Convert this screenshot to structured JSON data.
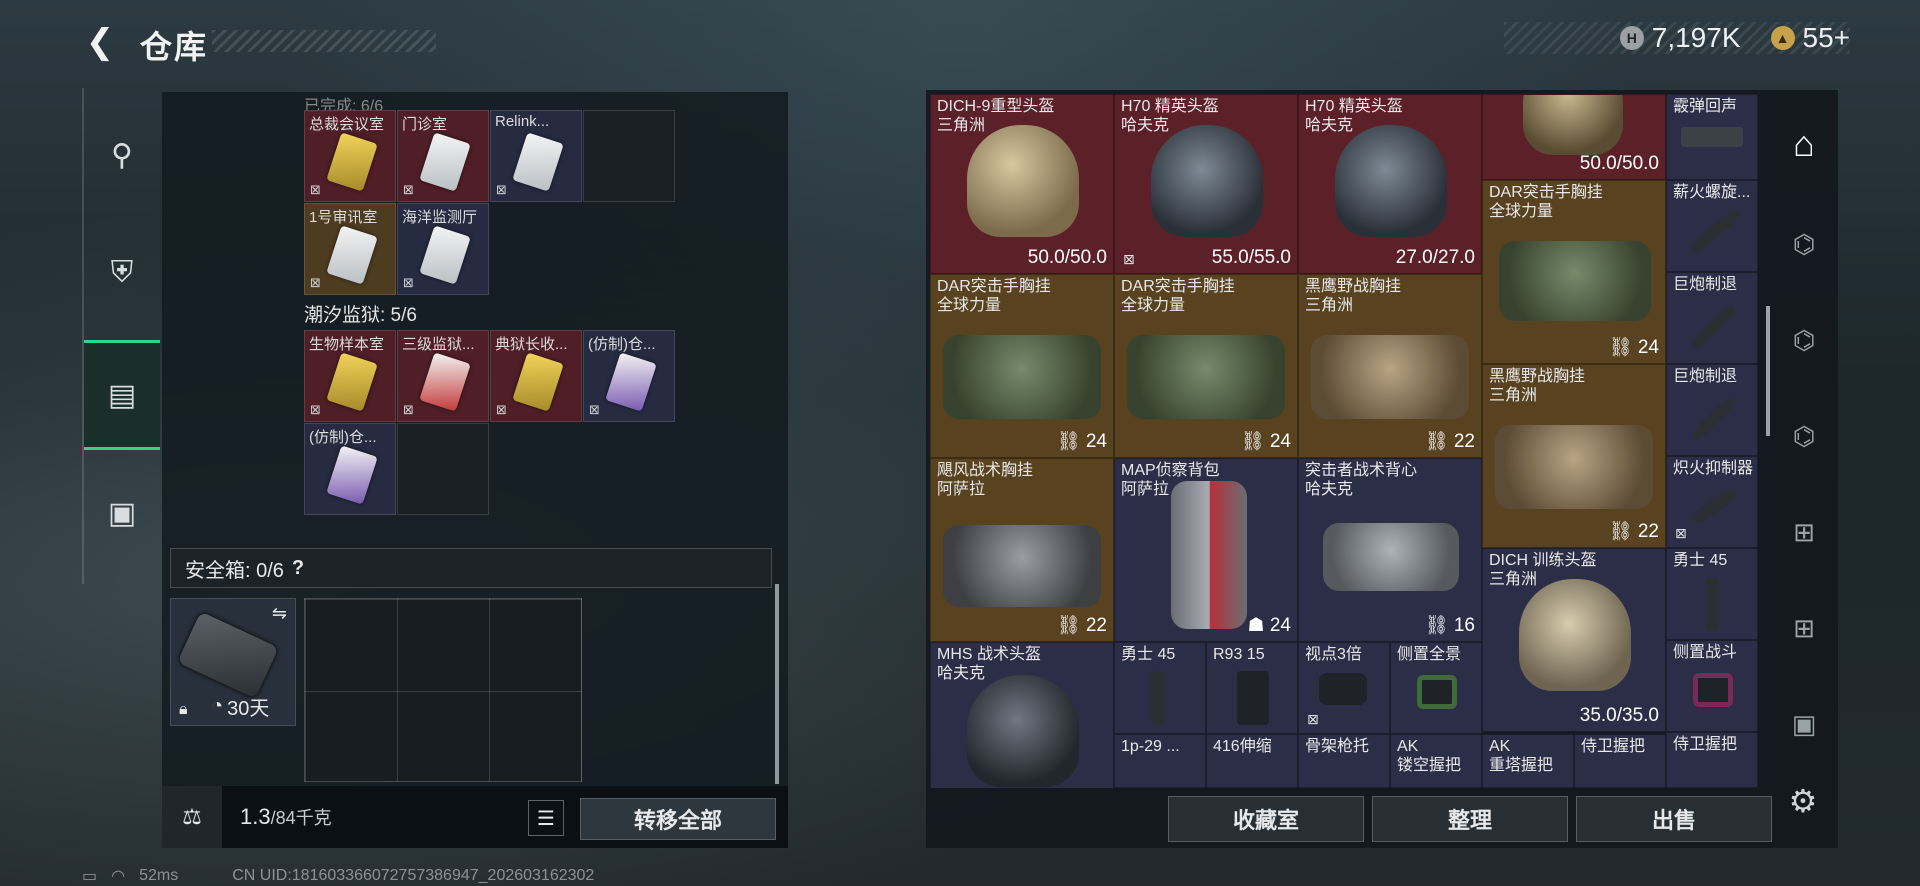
{
  "header": {
    "title": "仓库",
    "back_icon": "arrow-left-icon",
    "coins": "7,197K",
    "tickets": "55+"
  },
  "left_nav": [
    {
      "icon": "pistol-icon"
    },
    {
      "icon": "armor-icon"
    },
    {
      "icon": "keycard-icon",
      "active": true
    },
    {
      "icon": "briefcase-icon"
    }
  ],
  "left_panel": {
    "group1_cells": [
      "总裁会议室",
      "门诊室",
      "Relink...",
      "",
      "1号审讯室",
      "海洋监测厅"
    ],
    "prison_title": "潮汐监狱: 5/6",
    "prison_cells": [
      "生物样本室",
      "三级监狱...",
      "典狱长收...",
      "(仿制)仓...",
      "(仿制)仓..."
    ],
    "safe_box": {
      "label": "安全箱: 0/6",
      "help": "?",
      "duration": "30天"
    },
    "footer": {
      "weight": "1.3",
      "weight_max": "/84千克",
      "transfer_all": "转移全部"
    }
  },
  "inventory": [
    {
      "name": "DICH-9重型头盔",
      "origin": "三角洲",
      "value": "50.0/50.0"
    },
    {
      "name": "H70 精英头盔",
      "origin": "哈夫克",
      "value": "55.0/55.0"
    },
    {
      "name": "H70 精英头盔",
      "origin": "哈夫克",
      "value": "27.0/27.0"
    },
    {
      "name": "",
      "origin": "",
      "value": "50.0/50.0"
    },
    {
      "name": "霰弹回声",
      "origin": "",
      "value": ""
    },
    {
      "name": "DAR突击手胸挂",
      "origin": "全球力量",
      "value": "24"
    },
    {
      "name": "薪火螺旋...",
      "origin": "",
      "value": ""
    },
    {
      "name": "DAR突击手胸挂",
      "origin": "全球力量",
      "value": "24"
    },
    {
      "name": "DAR突击手胸挂",
      "origin": "全球力量",
      "value": "24"
    },
    {
      "name": "黑鹰野战胸挂",
      "origin": "三角洲",
      "value": "22"
    },
    {
      "name": "巨炮制退",
      "origin": "",
      "value": ""
    },
    {
      "name": "黑鹰野战胸挂",
      "origin": "三角洲",
      "value": "22"
    },
    {
      "name": "巨炮制退",
      "origin": "",
      "value": ""
    },
    {
      "name": "飓风战术胸挂",
      "origin": "阿萨拉",
      "value": "22"
    },
    {
      "name": "MAP侦察背包",
      "origin": "阿萨拉",
      "value": "24"
    },
    {
      "name": "突击者战术背心",
      "origin": "哈夫克",
      "value": "16"
    },
    {
      "name": "炽火抑制器",
      "origin": "",
      "value": ""
    },
    {
      "name": "DICH 训练头盔",
      "origin": "三角洲",
      "value": "35.0/35.0"
    },
    {
      "name": "勇士 45",
      "origin": "",
      "value": ""
    },
    {
      "name": "MHS 战术头盔",
      "origin": "哈夫克",
      "value": ""
    },
    {
      "name": "勇士 45",
      "origin": "",
      "value": ""
    },
    {
      "name": "R93 15",
      "origin": "",
      "value": ""
    },
    {
      "name": "视点3倍",
      "origin": "",
      "value": ""
    },
    {
      "name": "侧置全景",
      "origin": "",
      "value": ""
    },
    {
      "name": "侧置战斗",
      "origin": "",
      "value": ""
    },
    {
      "name": "1p-29 ...",
      "origin": "",
      "value": ""
    },
    {
      "name": "416伸缩",
      "origin": "",
      "value": ""
    },
    {
      "name": "骨架枪托",
      "origin": "",
      "value": ""
    },
    {
      "name": "AK",
      "origin": "镂空握把",
      "value": ""
    },
    {
      "name": "AK",
      "origin": "重塔握把",
      "value": ""
    },
    {
      "name": "侍卫握把",
      "origin": "",
      "value": ""
    },
    {
      "name": "侍卫握把",
      "origin": "",
      "value": ""
    }
  ],
  "right_tabs": [
    {
      "icon": "all-items-icon",
      "active": true
    },
    {
      "icon": "armor-tab-icon"
    },
    {
      "icon": "armor-tab-icon"
    },
    {
      "icon": "vest-tab-icon"
    },
    {
      "icon": "add-tab-icon"
    },
    {
      "icon": "add-tab-icon"
    },
    {
      "icon": "tab-icon"
    }
  ],
  "buttons": {
    "collection": "收藏室",
    "sort": "整理",
    "sell": "出售"
  },
  "status": {
    "ping": "52ms",
    "uid": "CN UID:181603366072757386947_202603162302"
  },
  "colors": {
    "accent": "#2fd58a",
    "red_rarity": "#5a1e28",
    "gold_rarity": "#584220",
    "blue_rarity": "#2c2e48"
  }
}
